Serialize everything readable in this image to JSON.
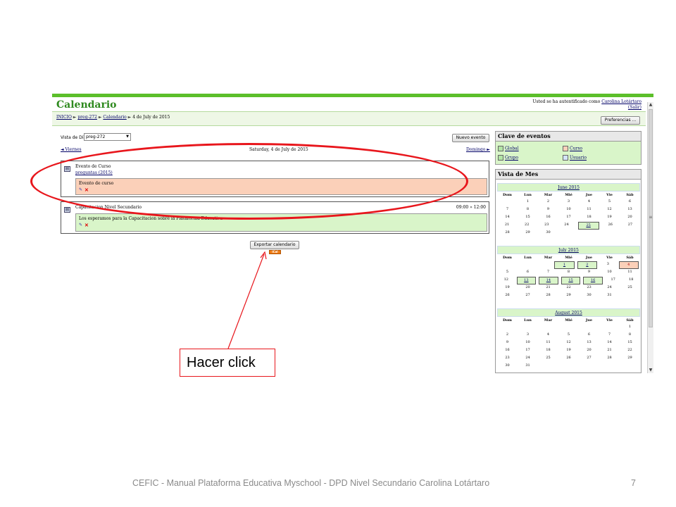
{
  "page": {
    "title": "Calendario"
  },
  "auth": {
    "line1": "Usted se ha autentificado como ",
    "user": "Carolina Lotártaro",
    "logout": "(Salir)"
  },
  "breadcrumb": {
    "items": [
      "INICIO",
      "preg-272",
      "Calendario",
      "4 de July de 2015"
    ]
  },
  "toolbar": {
    "preferences": "Preferencias ...",
    "new_event": "Nuevo evento",
    "export": "Exportar calendario",
    "ical": "iCal"
  },
  "dayview": {
    "label": "Vista de Día:",
    "select_value": "preg-272",
    "prev": "◄ Viernes",
    "current": "Saturday, 4 de July de 2015",
    "next": "Domingo ►"
  },
  "events": [
    {
      "name": "Evento de Curso",
      "course": "preguntas (2015)",
      "description": "Evento de curso",
      "time": ""
    },
    {
      "name": "Capacitacion Nivel Secundario",
      "course": "",
      "description": "Los esperamos para la Capacitacion sobre la Plataforma Educativa",
      "time": "09:00 » 12:00"
    }
  ],
  "legend": {
    "title": "Clave de eventos",
    "items": [
      "Global",
      "Curso",
      "Grupo",
      "Usuario"
    ],
    "colors": {
      "global": "#b3e5a6",
      "course": "#fbd0b9",
      "group": "#b3e5a6",
      "user": "#d2e4f7"
    }
  },
  "month_view": {
    "title": "Vista de Mes",
    "day_names": [
      "Dom",
      "Lun",
      "Mar",
      "Mié",
      "Jue",
      "Vie",
      "Sáb"
    ],
    "months": [
      {
        "name": "June 2015",
        "weeks": [
          [
            "",
            "1",
            "2",
            "3",
            "4",
            "5",
            "6"
          ],
          [
            "7",
            "8",
            "9",
            "10",
            "11",
            "12",
            "13"
          ],
          [
            "14",
            "15",
            "16",
            "17",
            "18",
            "19",
            "20"
          ],
          [
            "21",
            "22",
            "23",
            "24",
            "25",
            "26",
            "27"
          ],
          [
            "28",
            "29",
            "30",
            "",
            "",
            "",
            ""
          ]
        ],
        "events": [
          "25"
        ],
        "today": ""
      },
      {
        "name": "July 2015",
        "weeks": [
          [
            "",
            "",
            "",
            "1",
            "2",
            "3",
            "4"
          ],
          [
            "5",
            "6",
            "7",
            "8",
            "9",
            "10",
            "11"
          ],
          [
            "12",
            "13",
            "14",
            "15",
            "16",
            "17",
            "18"
          ],
          [
            "19",
            "20",
            "21",
            "22",
            "23",
            "24",
            "25"
          ],
          [
            "26",
            "27",
            "28",
            "29",
            "30",
            "31",
            ""
          ]
        ],
        "events": [
          "1",
          "2",
          "13",
          "14",
          "15",
          "16"
        ],
        "today": "4"
      },
      {
        "name": "August 2015",
        "weeks": [
          [
            "",
            "",
            "",
            "",
            "",
            "",
            "1"
          ],
          [
            "2",
            "3",
            "4",
            "5",
            "6",
            "7",
            "8"
          ],
          [
            "9",
            "10",
            "11",
            "12",
            "13",
            "14",
            "15"
          ],
          [
            "16",
            "17",
            "18",
            "19",
            "20",
            "21",
            "22"
          ],
          [
            "23",
            "24",
            "25",
            "26",
            "27",
            "28",
            "29"
          ],
          [
            "30",
            "31",
            "",
            "",
            "",
            "",
            ""
          ]
        ],
        "events": [],
        "today": ""
      }
    ]
  },
  "annotation": {
    "callout": "Hacer click"
  },
  "slide": {
    "footer": "CEFIC - Manual Plataforma Educativa Myschool - DPD Nivel Secundario Carolina Lotártaro",
    "page_number": "7"
  },
  "colors": {
    "accent_green": "#5cbf2a",
    "highlight_red": "#e8161c"
  }
}
